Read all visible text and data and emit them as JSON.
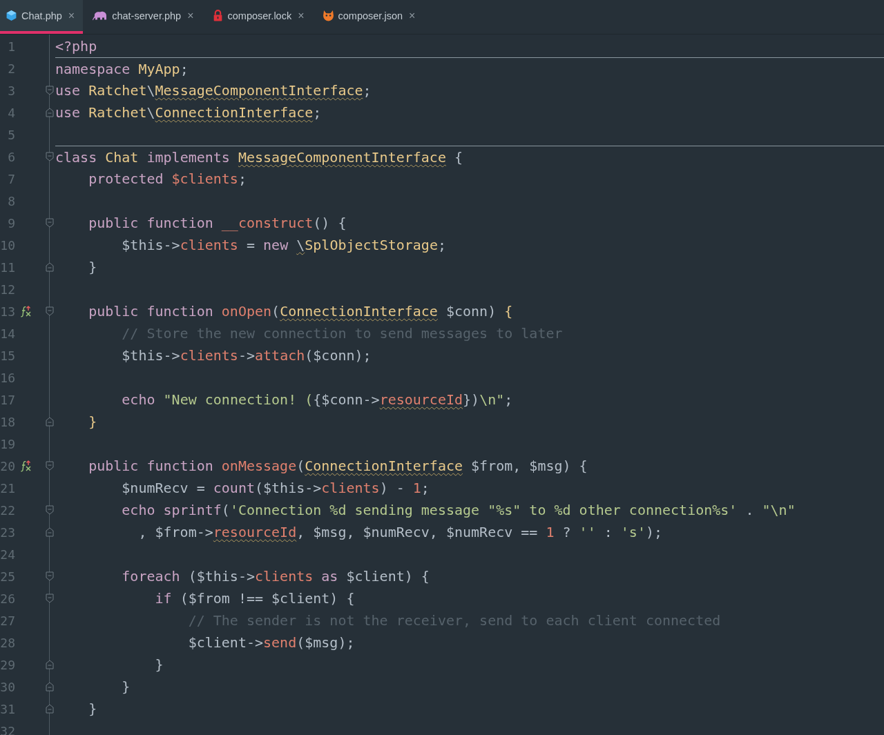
{
  "tabs": [
    {
      "label": "Chat.php",
      "selected": true,
      "close": "×"
    },
    {
      "label": "chat-server.php",
      "selected": false,
      "close": "×"
    },
    {
      "label": "composer.lock",
      "selected": false,
      "close": "×"
    },
    {
      "label": "composer.json",
      "selected": false,
      "close": "×"
    }
  ],
  "editor": {
    "lines": [
      {
        "number": "1",
        "kind": "plain",
        "override": false,
        "rule": false,
        "tokens": [
          {
            "kind": "kw",
            "text": "<?php"
          }
        ]
      },
      {
        "number": "2",
        "kind": "plain",
        "override": false,
        "rule": true,
        "tokens": [
          {
            "kind": "kw",
            "text": "namespace "
          },
          {
            "kind": "type",
            "text": "MyApp"
          },
          {
            "kind": "plain",
            "text": ";"
          }
        ]
      },
      {
        "number": "3",
        "kind": "fold_start",
        "override": false,
        "rule": false,
        "tokens": [
          {
            "kind": "kw",
            "text": "use "
          },
          {
            "kind": "type",
            "text": "Ratchet"
          },
          {
            "kind": "plain",
            "text": "\\"
          },
          {
            "kind": "type",
            "text": "MessageComponentInterface",
            "squiggle": true
          },
          {
            "kind": "plain",
            "text": ";"
          }
        ]
      },
      {
        "number": "4",
        "kind": "fold_end",
        "override": false,
        "rule": false,
        "tokens": [
          {
            "kind": "kw",
            "text": "use "
          },
          {
            "kind": "type",
            "text": "Ratchet"
          },
          {
            "kind": "plain",
            "text": "\\"
          },
          {
            "kind": "type",
            "text": "ConnectionInterface",
            "squiggle": true
          },
          {
            "kind": "plain",
            "text": ";"
          }
        ]
      },
      {
        "number": "5",
        "kind": "plain",
        "override": false,
        "rule": false
      },
      {
        "number": "6",
        "kind": "fold_start",
        "override": false,
        "rule": true,
        "tokens": [
          {
            "kind": "kw",
            "text": "class "
          },
          {
            "kind": "type",
            "text": "Chat"
          },
          {
            "kind": "kw",
            "text": " implements "
          },
          {
            "kind": "type",
            "text": "MessageComponentInterface",
            "squiggle": true
          },
          {
            "kind": "plain",
            "text": " {"
          }
        ]
      },
      {
        "number": "7",
        "kind": "plain",
        "override": false,
        "rule": false,
        "tokens": [
          {
            "kind": "kw",
            "text": "    protected "
          },
          {
            "kind": "prop",
            "text": "$clients"
          },
          {
            "kind": "plain",
            "text": ";"
          }
        ]
      },
      {
        "number": "8",
        "kind": "plain",
        "override": false,
        "rule": false
      },
      {
        "number": "9",
        "kind": "fold_start",
        "override": false,
        "rule": false,
        "tokens": [
          {
            "kind": "kw",
            "text": "    public function "
          },
          {
            "kind": "fn",
            "text": "__construct"
          },
          {
            "kind": "plain",
            "text": "() {"
          }
        ]
      },
      {
        "number": "10",
        "kind": "plain",
        "override": false,
        "rule": false,
        "tokens": [
          {
            "kind": "plain",
            "text": "        $this->"
          },
          {
            "kind": "prop",
            "text": "clients"
          },
          {
            "kind": "plain",
            "text": " = "
          },
          {
            "kind": "kw",
            "text": "new "
          },
          {
            "kind": "plain",
            "text": "\\",
            "squiggle": true
          },
          {
            "kind": "type",
            "text": "SplObjectStorage"
          },
          {
            "kind": "plain",
            "text": ";"
          }
        ]
      },
      {
        "number": "11",
        "kind": "fold_end",
        "override": false,
        "rule": false,
        "tokens": [
          {
            "kind": "plain",
            "text": "    }"
          }
        ]
      },
      {
        "number": "12",
        "kind": "plain",
        "override": false,
        "rule": false
      },
      {
        "number": "13",
        "kind": "fold_start",
        "override": true,
        "rule": false,
        "tokens": [
          {
            "kind": "kw",
            "text": "    public function "
          },
          {
            "kind": "fn",
            "text": "onOpen"
          },
          {
            "kind": "plain",
            "text": "("
          },
          {
            "kind": "type",
            "text": "ConnectionInterface",
            "squiggle": true
          },
          {
            "kind": "plain",
            "text": " $conn) "
          },
          {
            "kind": "type",
            "text": "{"
          }
        ]
      },
      {
        "number": "14",
        "kind": "plain",
        "override": false,
        "rule": false,
        "tokens": [
          {
            "kind": "com",
            "text": "        // Store the new connection to send messages to later"
          }
        ]
      },
      {
        "number": "15",
        "kind": "plain",
        "override": false,
        "rule": false,
        "tokens": [
          {
            "kind": "plain",
            "text": "        $this->"
          },
          {
            "kind": "prop",
            "text": "clients"
          },
          {
            "kind": "plain",
            "text": "->"
          },
          {
            "kind": "fn",
            "text": "attach"
          },
          {
            "kind": "plain",
            "text": "($conn);"
          }
        ]
      },
      {
        "number": "16",
        "kind": "plain",
        "override": false,
        "rule": false
      },
      {
        "number": "17",
        "kind": "plain",
        "override": false,
        "rule": false,
        "tokens": [
          {
            "kind": "kw",
            "text": "        echo "
          },
          {
            "kind": "str",
            "text": "\"New connection! ("
          },
          {
            "kind": "plain",
            "text": "{$conn->"
          },
          {
            "kind": "prop",
            "text": "resourceId",
            "squiggle": true
          },
          {
            "kind": "plain",
            "text": "})"
          },
          {
            "kind": "str",
            "text": "\\n\""
          },
          {
            "kind": "plain",
            "text": ";"
          }
        ]
      },
      {
        "number": "18",
        "kind": "fold_end",
        "override": false,
        "rule": false,
        "tokens": [
          {
            "kind": "type",
            "text": "    }"
          }
        ]
      },
      {
        "number": "19",
        "kind": "plain",
        "override": false,
        "rule": false
      },
      {
        "number": "20",
        "kind": "fold_start",
        "override": true,
        "rule": false,
        "tokens": [
          {
            "kind": "kw",
            "text": "    public function "
          },
          {
            "kind": "fn",
            "text": "onMessage"
          },
          {
            "kind": "plain",
            "text": "("
          },
          {
            "kind": "type",
            "text": "ConnectionInterface",
            "squiggle": true
          },
          {
            "kind": "plain",
            "text": " $from, $msg) {"
          }
        ]
      },
      {
        "number": "21",
        "kind": "plain",
        "override": false,
        "rule": false,
        "tokens": [
          {
            "kind": "plain",
            "text": "        $numRecv = "
          },
          {
            "kind": "kw",
            "text": "count"
          },
          {
            "kind": "plain",
            "text": "($this->"
          },
          {
            "kind": "prop",
            "text": "clients"
          },
          {
            "kind": "plain",
            "text": ") - "
          },
          {
            "kind": "num",
            "text": "1"
          },
          {
            "kind": "plain",
            "text": ";"
          }
        ]
      },
      {
        "number": "22",
        "kind": "fold_start",
        "override": false,
        "rule": false,
        "tokens": [
          {
            "kind": "kw",
            "text": "        echo sprintf"
          },
          {
            "kind": "plain",
            "text": "("
          },
          {
            "kind": "str",
            "text": "'Connection %d sending message \"%s\" to %d other connection%s'"
          },
          {
            "kind": "plain",
            "text": " . "
          },
          {
            "kind": "str",
            "text": "\"\\n\""
          }
        ]
      },
      {
        "number": "23",
        "kind": "fold_end",
        "override": false,
        "rule": false,
        "tokens": [
          {
            "kind": "plain",
            "text": "          , $from->"
          },
          {
            "kind": "prop",
            "text": "resourceId",
            "squiggle": true
          },
          {
            "kind": "plain",
            "text": ", $msg, $numRecv, $numRecv == "
          },
          {
            "kind": "num",
            "text": "1"
          },
          {
            "kind": "plain",
            "text": " ? "
          },
          {
            "kind": "str",
            "text": "''"
          },
          {
            "kind": "plain",
            "text": " : "
          },
          {
            "kind": "str",
            "text": "'s'"
          },
          {
            "kind": "plain",
            "text": ");"
          }
        ]
      },
      {
        "number": "24",
        "kind": "plain",
        "override": false,
        "rule": false
      },
      {
        "number": "25",
        "kind": "fold_start",
        "override": false,
        "rule": false,
        "tokens": [
          {
            "kind": "kw",
            "text": "        foreach "
          },
          {
            "kind": "plain",
            "text": "($this->"
          },
          {
            "kind": "prop",
            "text": "clients"
          },
          {
            "kind": "kw",
            "text": " as "
          },
          {
            "kind": "plain",
            "text": "$client) {"
          }
        ]
      },
      {
        "number": "26",
        "kind": "fold_start",
        "override": false,
        "rule": false,
        "tokens": [
          {
            "kind": "kw",
            "text": "            if "
          },
          {
            "kind": "plain",
            "text": "($from !== $client) {"
          }
        ]
      },
      {
        "number": "27",
        "kind": "plain",
        "override": false,
        "rule": false,
        "tokens": [
          {
            "kind": "com",
            "text": "                // The sender is not the receiver, send to each client connected"
          }
        ]
      },
      {
        "number": "28",
        "kind": "plain",
        "override": false,
        "rule": false,
        "tokens": [
          {
            "kind": "plain",
            "text": "                $client->"
          },
          {
            "kind": "fn",
            "text": "send"
          },
          {
            "kind": "plain",
            "text": "($msg);"
          }
        ]
      },
      {
        "number": "29",
        "kind": "fold_end",
        "override": false,
        "rule": false,
        "tokens": [
          {
            "kind": "plain",
            "text": "            }"
          }
        ]
      },
      {
        "number": "30",
        "kind": "fold_end",
        "override": false,
        "rule": false,
        "tokens": [
          {
            "kind": "plain",
            "text": "        }"
          }
        ]
      },
      {
        "number": "31",
        "kind": "fold_end",
        "override": false,
        "rule": false,
        "tokens": [
          {
            "kind": "plain",
            "text": "    }"
          }
        ]
      },
      {
        "number": "32",
        "kind": "plain",
        "override": false,
        "rule": false
      }
    ]
  }
}
